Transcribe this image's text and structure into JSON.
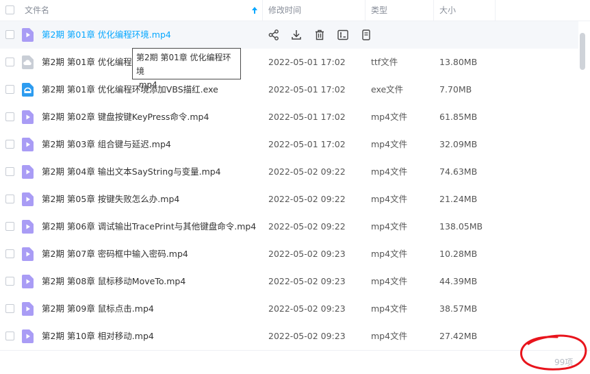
{
  "header": {
    "name_label": "文件名",
    "date_label": "修改时间",
    "type_label": "类型",
    "size_label": "大小"
  },
  "colors": {
    "accent": "#06a7ff",
    "video_icon": "#a99cf5",
    "exe_icon": "#2d9cf0",
    "cloud_icon": "#c9ced6"
  },
  "files": [
    {
      "name": "第2期 第01章 优化编程环境.mp4",
      "date": "",
      "type": "",
      "size": "",
      "icon": "video-file-icon"
    },
    {
      "name": "第2期 第01章 优化编程环",
      "date": "2022-05-01 17:02",
      "type": "ttf文件",
      "size": "13.80MB",
      "icon": "cloud-file-icon"
    },
    {
      "name": "第2期 第01章 优化编程环境添加VBS描红.exe",
      "date": "2022-05-01 17:02",
      "type": "exe文件",
      "size": "7.70MB",
      "icon": "exe-file-icon"
    },
    {
      "name": "第2期 第02章 键盘按键KeyPress命令.mp4",
      "date": "2022-05-01 17:02",
      "type": "mp4文件",
      "size": "61.85MB",
      "icon": "video-file-icon"
    },
    {
      "name": "第2期 第03章 组合键与延迟.mp4",
      "date": "2022-05-01 17:02",
      "type": "mp4文件",
      "size": "32.09MB",
      "icon": "video-file-icon"
    },
    {
      "name": "第2期 第04章 输出文本SayString与变量.mp4",
      "date": "2022-05-02 09:22",
      "type": "mp4文件",
      "size": "74.63MB",
      "icon": "video-file-icon"
    },
    {
      "name": "第2期 第05章 按键失败怎么办.mp4",
      "date": "2022-05-02 09:22",
      "type": "mp4文件",
      "size": "21.24MB",
      "icon": "video-file-icon"
    },
    {
      "name": "第2期 第06章 调试输出TracePrint与其他键盘命令.mp4",
      "date": "2022-05-02 09:22",
      "type": "mp4文件",
      "size": "138.05MB",
      "icon": "video-file-icon"
    },
    {
      "name": "第2期 第07章 密码框中输入密码.mp4",
      "date": "2022-05-02 09:23",
      "type": "mp4文件",
      "size": "10.28MB",
      "icon": "video-file-icon"
    },
    {
      "name": "第2期 第08章 鼠标移动MoveTo.mp4",
      "date": "2022-05-02 09:23",
      "type": "mp4文件",
      "size": "44.39MB",
      "icon": "video-file-icon"
    },
    {
      "name": "第2期 第09章 鼠标点击.mp4",
      "date": "2022-05-02 09:23",
      "type": "mp4文件",
      "size": "38.57MB",
      "icon": "video-file-icon"
    },
    {
      "name": "第2期 第10章 相对移动.mp4",
      "date": "2022-05-02 09:23",
      "type": "mp4文件",
      "size": "27.42MB",
      "icon": "video-file-icon"
    }
  ],
  "tooltip": {
    "line1": "第2期 第01章 优化编程环境",
    "line2": ".mp4"
  },
  "row_actions": [
    "share-icon",
    "download-icon",
    "delete-icon",
    "rename-icon",
    "more-icon"
  ],
  "footer": {
    "count": "99项"
  }
}
